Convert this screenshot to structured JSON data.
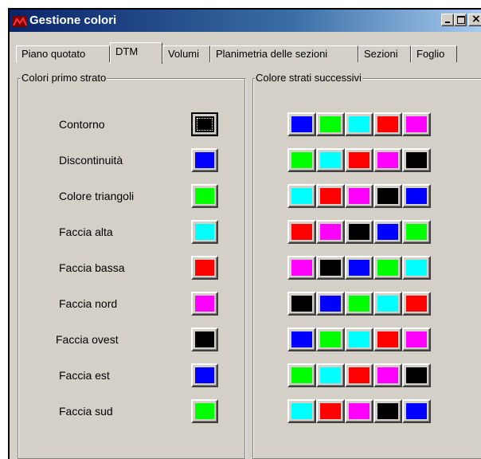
{
  "window": {
    "title": "Gestione colori"
  },
  "tabs": [
    "Piano quotato",
    "DTM",
    "Volumi",
    "Planimetria delle sezioni",
    "Sezioni",
    "Foglio"
  ],
  "active_tab": "DTM",
  "colors": {
    "blue": "#0000ff",
    "green": "#00ff00",
    "cyan": "#00ffff",
    "red": "#ff0000",
    "magenta": "#ff00ff",
    "black": "#000000"
  },
  "first_layer": {
    "title": "Colori primo strato",
    "rows": [
      {
        "label": "Contorno",
        "color": "#000000"
      },
      {
        "label": "Discontinuità",
        "color": "#0000ff"
      },
      {
        "label": "Colore triangoli",
        "color": "#00ff00"
      },
      {
        "label": "Faccia alta",
        "color": "#00ffff"
      },
      {
        "label": "Faccia bassa",
        "color": "#ff0000"
      },
      {
        "label": "Faccia nord",
        "color": "#ff00ff"
      },
      {
        "label": "Faccia ovest",
        "color": "#000000"
      },
      {
        "label": "Faccia est",
        "color": "#0000ff"
      },
      {
        "label": "Faccia sud",
        "color": "#00ff00"
      }
    ]
  },
  "next_layers": {
    "title": "Colore strati successivi",
    "rows": [
      [
        "#0000ff",
        "#00ff00",
        "#00ffff",
        "#ff0000",
        "#ff00ff"
      ],
      [
        "#00ff00",
        "#00ffff",
        "#ff0000",
        "#ff00ff",
        "#000000"
      ],
      [
        "#00ffff",
        "#ff0000",
        "#ff00ff",
        "#000000",
        "#0000ff"
      ],
      [
        "#ff0000",
        "#ff00ff",
        "#000000",
        "#0000ff",
        "#00ff00"
      ],
      [
        "#ff00ff",
        "#000000",
        "#0000ff",
        "#00ff00",
        "#00ffff"
      ],
      [
        "#000000",
        "#0000ff",
        "#00ff00",
        "#00ffff",
        "#ff0000"
      ],
      [
        "#0000ff",
        "#00ff00",
        "#00ffff",
        "#ff0000",
        "#ff00ff"
      ],
      [
        "#00ff00",
        "#00ffff",
        "#ff0000",
        "#ff00ff",
        "#000000"
      ],
      [
        "#00ffff",
        "#ff0000",
        "#ff00ff",
        "#000000",
        "#0000ff"
      ]
    ]
  }
}
